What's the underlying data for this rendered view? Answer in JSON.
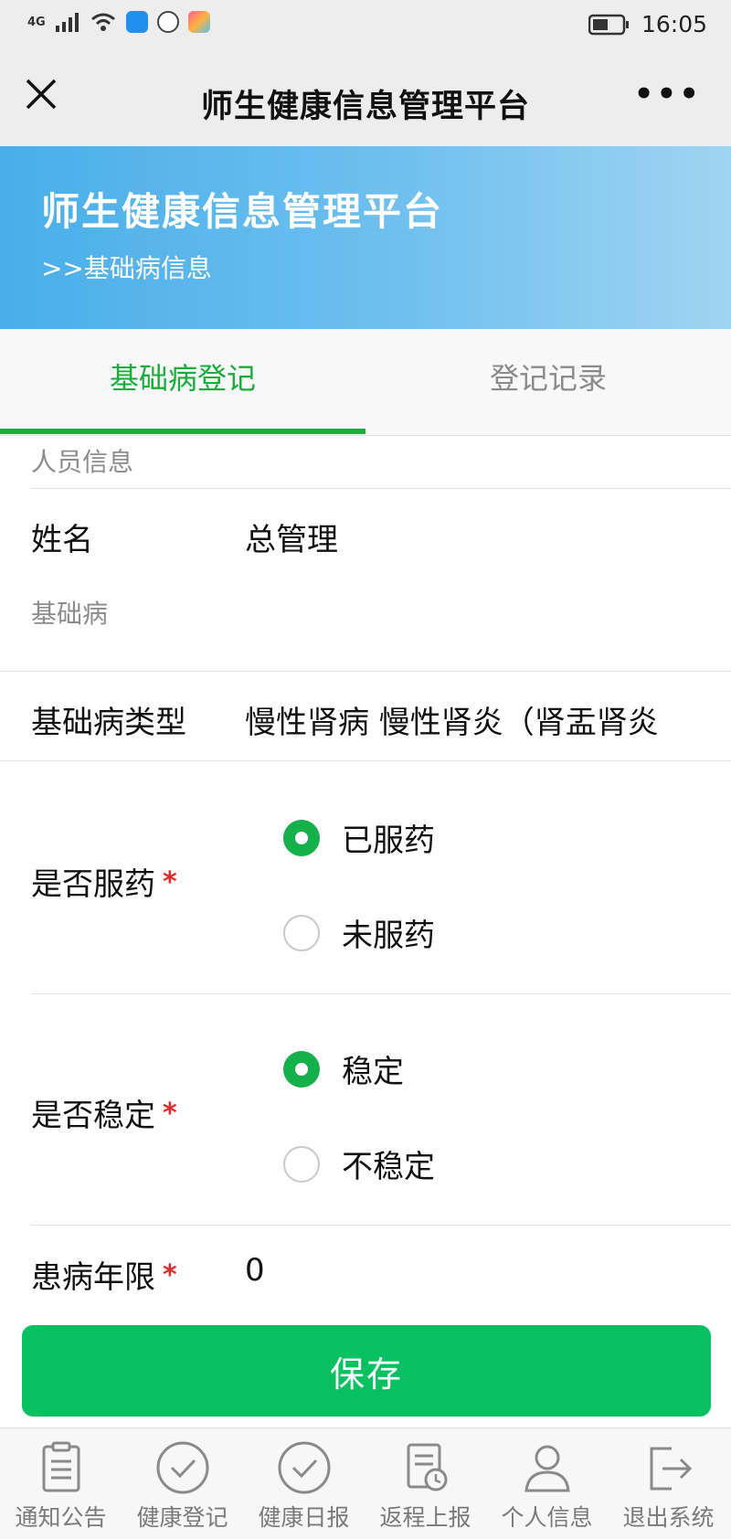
{
  "status_bar": {
    "network": "4G",
    "time": "16:05"
  },
  "nav": {
    "title": "师生健康信息管理平台"
  },
  "banner": {
    "title": "师生健康信息管理平台",
    "subtitle": ">>基础病信息"
  },
  "tabs": [
    {
      "label": "基础病登记",
      "active": true
    },
    {
      "label": "登记记录",
      "active": false
    }
  ],
  "sections": {
    "person_info": "人员信息",
    "disease": "基础病"
  },
  "form": {
    "name_label": "姓名",
    "name_value": "总管理",
    "type_label": "基础病类型",
    "type_value": "慢性肾病 慢性肾炎（肾盂肾炎",
    "medication_label": "是否服药",
    "medication_options": [
      "已服药",
      "未服药"
    ],
    "medication_selected": "已服药",
    "stable_label": "是否稳定",
    "stable_options": [
      "稳定",
      "不稳定"
    ],
    "stable_selected": "稳定",
    "years_label": "患病年限",
    "years_value": "0",
    "required_mark": "*"
  },
  "save_label": "保存",
  "bottom_nav": [
    {
      "label": "通知公告",
      "icon": "clipboard-icon"
    },
    {
      "label": "健康登记",
      "icon": "check-circle-icon"
    },
    {
      "label": "健康日报",
      "icon": "check-circle-icon"
    },
    {
      "label": "返程上报",
      "icon": "report-clock-icon"
    },
    {
      "label": "个人信息",
      "icon": "person-icon"
    },
    {
      "label": "退出系统",
      "icon": "logout-icon"
    }
  ],
  "colors": {
    "accent_green": "#07c160",
    "tab_green": "#19ad3c",
    "required_red": "#e02b2b",
    "banner_blue": "#49aee9"
  }
}
